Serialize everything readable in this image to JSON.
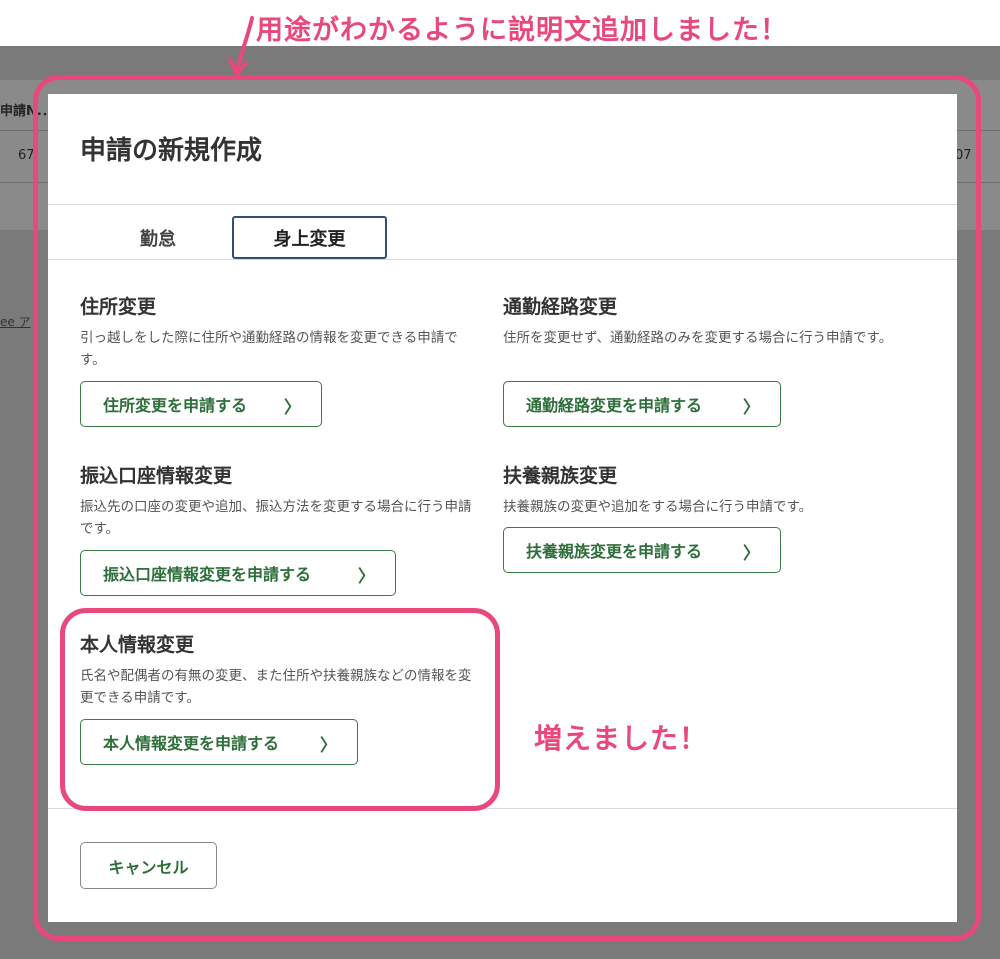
{
  "annotations": {
    "top": "用途がわかるように説明文追加しました！",
    "middle": "増えました！"
  },
  "background": {
    "header_fragment": "申請N.．",
    "row_left": "67",
    "row_right": "07",
    "link_fragment": "ee ア"
  },
  "modal": {
    "title": "申請の新規作成",
    "tabs": [
      {
        "label": "勤怠",
        "active": false
      },
      {
        "label": "身上変更",
        "active": true
      }
    ],
    "sections": [
      {
        "title": "住所変更",
        "description": "引っ越しをした際に住所や通勤経路の情報を変更できる申請です。",
        "button": "住所変更を申請する"
      },
      {
        "title": "通勤経路変更",
        "description": "住所を変更せず、通勤経路のみを変更する場合に行う申請です。",
        "button": "通勤経路変更を申請する"
      },
      {
        "title": "振込口座情報変更",
        "description": "振込先の口座の変更や追加、振込方法を変更する場合に行う申請です。",
        "button": "振込口座情報変更を申請する"
      },
      {
        "title": "扶養親族変更",
        "description": "扶養親族の変更や追加をする場合に行う申請です。",
        "button": "扶養親族変更を申請する"
      },
      {
        "title": "本人情報変更",
        "description": "氏名や配偶者の有無の変更、また住所や扶養親族などの情報を変更できる申請です。",
        "button": "本人情報変更を申請する"
      }
    ],
    "chevron": "〉",
    "cancel": "キャンセル"
  },
  "colors": {
    "annotation_pink": "#e8487a",
    "button_green": "#2e6e3a",
    "active_tab_border": "#2f4f75"
  }
}
